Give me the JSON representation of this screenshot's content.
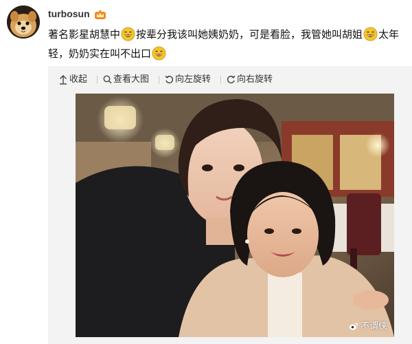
{
  "post": {
    "username": "turbosun",
    "text_segments": [
      "著名影星胡慧中",
      "按辈分我该叫她姨奶奶，可是看脸，我管她叫胡姐",
      "太年轻，奶奶实在叫不出口"
    ]
  },
  "toolbar": {
    "collapse_label": "收起",
    "view_large_label": "查看大图",
    "rotate_left_label": "向左旋转",
    "rotate_right_label": "向右旋转"
  },
  "watermark": {
    "text": "不谓侠"
  },
  "icons": {
    "avatar": "dog-avatar",
    "badge": "vip-crown-badge",
    "emoji": "laughing-emoji",
    "collapse": "collapse-arrow-icon",
    "view_large": "search-icon",
    "rotate_left": "rotate-left-icon",
    "rotate_right": "rotate-right-icon",
    "watermark": "weibo-logo-icon"
  },
  "colors": {
    "emoji_face": "#f3c52a",
    "badge_orange": "#f28a1f",
    "media_background": "#f3f3f3"
  }
}
